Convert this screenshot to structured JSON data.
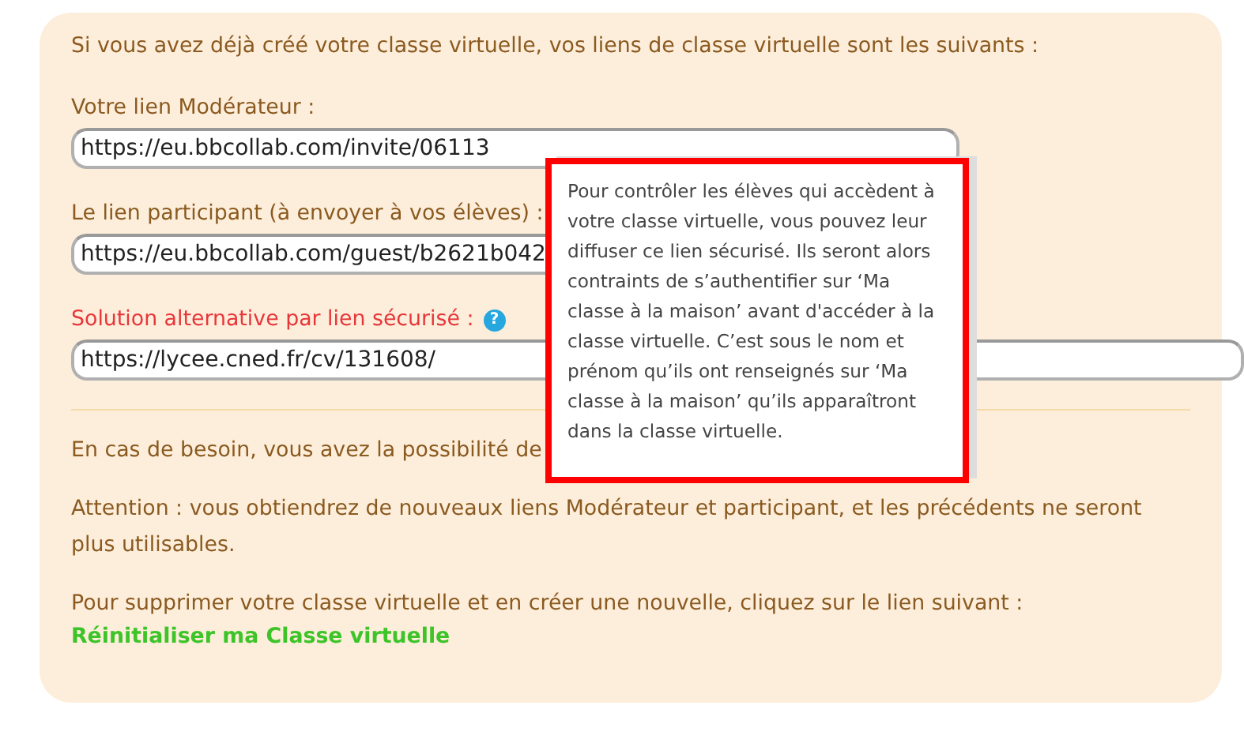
{
  "intro": "Si vous avez déjà créé votre classe virtuelle, vos liens de classe virtuelle sont les suivants :",
  "links": [
    {
      "label": "Votre lien Modérateur :",
      "kind": "normal",
      "value": "https://eu.bbcollab.com/invite/06113"
    },
    {
      "label": "Le lien participant (à envoyer à vos élèves) :",
      "kind": "normal",
      "value": "https://eu.bbcollab.com/guest/b2621b042"
    },
    {
      "label": "Solution alternative par lien sécurisé :",
      "kind": "alert",
      "value": "https://lycee.cned.fr/cv/131608/",
      "help": "?"
    }
  ],
  "tooltip": "Pour contrôler les élèves qui accèdent à votre classe virtuelle, vous pouvez leur diffuser ce lien sécurisé. Ils seront alors contraints de s’authentifier sur ‘Ma classe à la maison’ avant d'accéder à la classe virtuelle. C’est sous le nom et prénom qu’ils ont renseignés sur ‘Ma classe à la maison’ qu’ils apparaîtront dans la classe virtuelle.",
  "paragraphs": [
    "En cas de besoin, vous avez la possibilité de",
    "Attention : vous obtiendrez de nouveaux liens Modérateur et participant, et les précédents ne seront plus utilisables.",
    "Pour supprimer votre classe virtuelle et en créer une nouvelle, cliquez sur le lien suivant :"
  ],
  "reset_link": "Réinitialiser ma Classe virtuelle"
}
